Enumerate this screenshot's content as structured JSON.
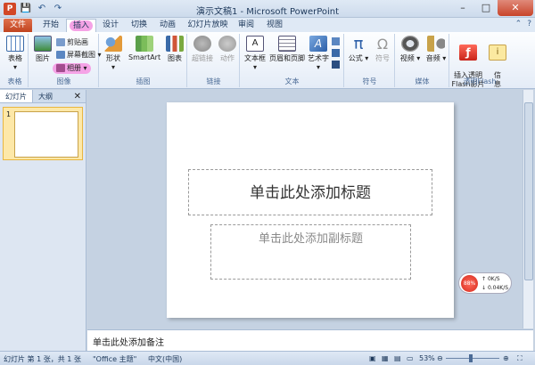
{
  "window": {
    "title": "演示文稿1 - Microsoft PowerPoint"
  },
  "qat": {
    "save": "💾",
    "undo": "↶",
    "redo": "↷"
  },
  "tabs": [
    {
      "id": "file",
      "label": "文件"
    },
    {
      "id": "home",
      "label": "开始"
    },
    {
      "id": "insert",
      "label": "插入",
      "active": true
    },
    {
      "id": "design",
      "label": "设计"
    },
    {
      "id": "transitions",
      "label": "切换"
    },
    {
      "id": "animations",
      "label": "动画"
    },
    {
      "id": "slideshow",
      "label": "幻灯片放映"
    },
    {
      "id": "review",
      "label": "审阅"
    },
    {
      "id": "view",
      "label": "视图"
    }
  ],
  "ribbon": {
    "groups": {
      "tables": {
        "label": "表格",
        "table": "表格"
      },
      "images": {
        "label": "图像",
        "picture": "图片",
        "clipart": "剪贴画",
        "screenshot": "屏幕截图",
        "album": "相册"
      },
      "illustrations": {
        "label": "插图",
        "shapes": "形状",
        "smartart": "SmartArt",
        "chart": "图表"
      },
      "links": {
        "label": "链接",
        "hyperlink": "超链接",
        "action": "动作"
      },
      "text": {
        "label": "文本",
        "textbox": "文本框",
        "headerfooter": "页眉和页脚",
        "wordart": "艺术字"
      },
      "symbols": {
        "label": "符号",
        "equation": "公式",
        "symbol": "符号"
      },
      "media": {
        "label": "媒体",
        "video": "视频",
        "audio": "音频"
      },
      "flash": {
        "label": "透明Flash",
        "insert": "插入透明\nFlash影片",
        "info": "信\n息"
      }
    }
  },
  "leftpane": {
    "tab_slides": "幻灯片",
    "tab_outline": "大纲",
    "thumb_number": "1"
  },
  "slide": {
    "title_placeholder": "单击此处添加标题",
    "subtitle_placeholder": "单击此处添加副标题"
  },
  "netwidget": {
    "percent": "88%",
    "up": "0K/S",
    "down": "0.04K/S"
  },
  "notes": {
    "placeholder": "单击此处添加备注"
  },
  "status": {
    "slide_info": "幻灯片 第 1 张，共 1 张",
    "theme": "\"Office 主题\"",
    "language": "中文(中国)",
    "zoom": "53%"
  },
  "colors": {
    "accent": "#c0431f",
    "highlight": "#f5a3e6",
    "ribbon_bg": "#e4ecf7"
  }
}
